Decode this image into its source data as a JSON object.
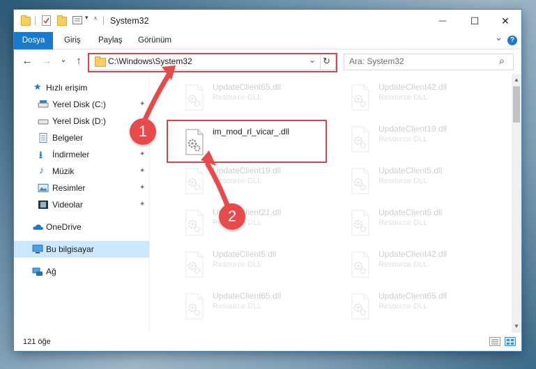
{
  "window": {
    "title": "System32",
    "controls": {
      "minimize": "—",
      "maximize": "☐",
      "close": "✕"
    }
  },
  "ribbon": {
    "tabs": [
      "Dosya",
      "Giriş",
      "Paylaş",
      "Görünüm"
    ],
    "expand_glyph": "⌄",
    "help_glyph": "?"
  },
  "navigation": {
    "back": "←",
    "forward": "→",
    "recent": "⌄",
    "up": "↑",
    "address": "C:\\Windows\\System32",
    "address_dropdown": "⌄",
    "refresh": "↻",
    "search_placeholder": "Ara: System32",
    "search_icon": "⌕"
  },
  "sidebar": {
    "items": [
      {
        "label": "Hızlı erişim",
        "icon": "star-icon",
        "pinned": false
      },
      {
        "label": "Yerel Disk (C:)",
        "icon": "drive-icon",
        "pinned": true
      },
      {
        "label": "Yerel Disk (D:)",
        "icon": "drive-icon",
        "pinned": false
      },
      {
        "label": "Belgeler",
        "icon": "documents-icon",
        "pinned": true
      },
      {
        "label": "İndirmeler",
        "icon": "download-icon",
        "pinned": true
      },
      {
        "label": "Müzik",
        "icon": "music-icon",
        "pinned": true
      },
      {
        "label": "Resimler",
        "icon": "pictures-icon",
        "pinned": true
      },
      {
        "label": "Videolar",
        "icon": "videos-icon",
        "pinned": true
      },
      {
        "label": "OneDrive",
        "icon": "cloud-icon",
        "pinned": false
      },
      {
        "label": "Bu bilgisayar",
        "icon": "computer-icon",
        "pinned": false,
        "selected": true
      },
      {
        "label": "Ağ",
        "icon": "network-icon",
        "pinned": false
      }
    ],
    "pin_glyph": "📌"
  },
  "files": [
    {
      "name": "UpdateClient65.dll",
      "type": "Resource DLL"
    },
    {
      "name": "UpdateClient42.dll",
      "type": "Resource DLL"
    },
    {
      "name": "im_mod_rl_vicar_.dll",
      "type": ""
    },
    {
      "name": "UpdateClient19.dll",
      "type": "Resource DLL"
    },
    {
      "name": "UpdateClient19.dll",
      "type": "Resource DLL"
    },
    {
      "name": "UpdateClient5.dll",
      "type": "Resource DLL"
    },
    {
      "name": "UpdateClient21.dll",
      "type": "Resource DLL"
    },
    {
      "name": "UpdateClient5.dll",
      "type": "Resource DLL"
    },
    {
      "name": "UpdateClient5.dll",
      "type": "Resource DLL"
    },
    {
      "name": "UpdateClient42.dll",
      "type": "Resource DLL"
    },
    {
      "name": "UpdateClient65.dll",
      "type": "Resource DLL"
    },
    {
      "name": "UpdateClient65.dll",
      "type": "Resource DLL"
    }
  ],
  "status": {
    "item_count": "121 öğe"
  },
  "annotations": {
    "step1": "1",
    "step2": "2",
    "color": "#e84a4a"
  }
}
